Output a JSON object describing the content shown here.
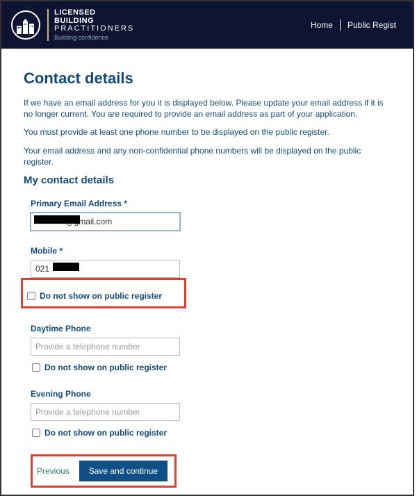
{
  "header": {
    "brand": {
      "line1": "LICENSED",
      "line2": "BUILDING",
      "line3": "PRACTITIONERS",
      "tagline": "Building confidence"
    },
    "nav": {
      "home": "Home",
      "public_register": "Public Regist"
    }
  },
  "page": {
    "title": "Contact details",
    "intro1": "If we have an email address for you it is displayed below. Please update your email address if it is no longer current. You are required to provide an email address as part of your application.",
    "intro2": "You must provide at least one phone number to be displayed on the public register.",
    "intro3": "Your email address and any non-confidential phone numbers will be displayed on the public register.",
    "section_title": "My contact details"
  },
  "fields": {
    "email": {
      "label": "Primary Email Address",
      "required": "*",
      "value": "             @gmail.com",
      "hide_label": ""
    },
    "mobile": {
      "label": "Mobile",
      "required": "*",
      "value": "021",
      "hide_label": "Do not show on public register"
    },
    "daytime": {
      "label": "Daytime Phone",
      "placeholder": "Provide a telephone number",
      "hide_label": "Do not show on public register"
    },
    "evening": {
      "label": "Evening Phone",
      "placeholder": "Provide a telephone number",
      "hide_label": "Do not show on public register"
    }
  },
  "buttons": {
    "previous": "Previous",
    "save": "Save and continue"
  }
}
